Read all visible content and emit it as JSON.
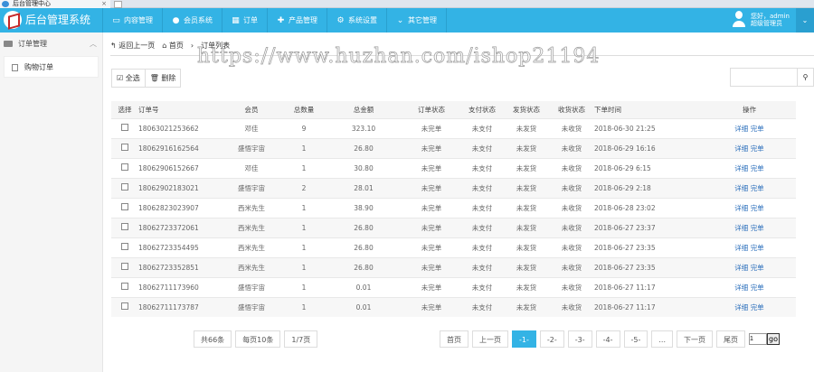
{
  "browser": {
    "tab_title": "后台管理中心",
    "close": "×"
  },
  "header": {
    "title": "后台管理系统",
    "nav": [
      "内容管理",
      "会员系统",
      "订单",
      "产品管理",
      "系统设置",
      "其它管理"
    ],
    "user_greeting": "您好，admin",
    "user_role": "超级管理员",
    "toggle": "⌄"
  },
  "sidebar": {
    "section": "订单管理",
    "items": [
      "购物订单"
    ]
  },
  "breadcrumb": {
    "back": "返回上一页",
    "home": "首页",
    "sep": "›",
    "current": "订单列表"
  },
  "watermark": "https://www.huzhan.com/ishop21194",
  "toolbar": {
    "select_all": "全选",
    "delete": "删除"
  },
  "search": {
    "placeholder": "",
    "icon": "search-icon"
  },
  "table": {
    "columns": [
      "选择",
      "订单号",
      "会员",
      "总数量",
      "总金额",
      "订单状态",
      "支付状态",
      "发货状态",
      "收货状态",
      "下单时间",
      "操作"
    ],
    "rows": [
      [
        "18063021253662",
        "邓佳",
        "9",
        "323.10",
        "未完单",
        "未支付",
        "未发货",
        "未收货",
        "2018-06-30 21:25"
      ],
      [
        "18062916162564",
        "盛悟宇宙",
        "1",
        "26.80",
        "未完单",
        "未支付",
        "未发货",
        "未收货",
        "2018-06-29 16:16"
      ],
      [
        "18062906152667",
        "邓佳",
        "1",
        "30.80",
        "未完单",
        "未支付",
        "未发货",
        "未收货",
        "2018-06-29 6:15"
      ],
      [
        "18062902183021",
        "盛悟宇宙",
        "2",
        "28.01",
        "未完单",
        "未支付",
        "未发货",
        "未收货",
        "2018-06-29 2:18"
      ],
      [
        "18062823023907",
        "西米先生",
        "1",
        "38.90",
        "未完单",
        "未支付",
        "未发货",
        "未收货",
        "2018-06-28 23:02"
      ],
      [
        "18062723372061",
        "西米先生",
        "1",
        "26.80",
        "未完单",
        "未支付",
        "未发货",
        "未收货",
        "2018-06-27 23:37"
      ],
      [
        "18062723354495",
        "西米先生",
        "1",
        "26.80",
        "未完单",
        "未支付",
        "未发货",
        "未收货",
        "2018-06-27 23:35"
      ],
      [
        "18062723352851",
        "西米先生",
        "1",
        "26.80",
        "未完单",
        "未支付",
        "未发货",
        "未收货",
        "2018-06-27 23:35"
      ],
      [
        "18062711173960",
        "盛悟宇宙",
        "1",
        "0.01",
        "未完单",
        "未支付",
        "未发货",
        "未收货",
        "2018-06-27 11:17"
      ],
      [
        "18062711173787",
        "盛悟宇宙",
        "1",
        "0.01",
        "未完单",
        "未支付",
        "未发货",
        "未收货",
        "2018-06-27 11:17"
      ]
    ],
    "actions": [
      "详细",
      "完单"
    ]
  },
  "pagination": {
    "total": "共66条",
    "per_page": "每页10条",
    "pages": "1/7页",
    "first": "首页",
    "prev": "上一页",
    "numbers": [
      "-1-",
      "-2-",
      "-3-",
      "-4-",
      "-5-",
      "..."
    ],
    "next": "下一页",
    "last": "尾页",
    "jump_value": "1",
    "go": "go"
  },
  "colors": {
    "header": "#33b3e5",
    "link": "#2a6ebb"
  }
}
